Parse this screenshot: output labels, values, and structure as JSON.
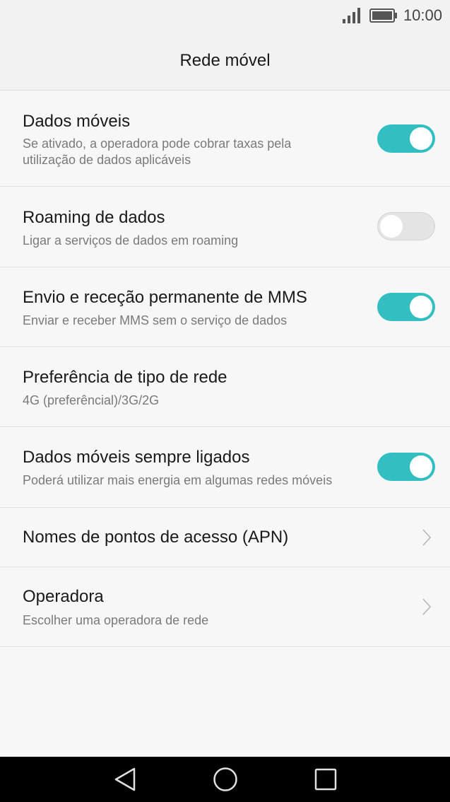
{
  "status_bar": {
    "signal_icon": "signal-bars-icon",
    "battery_icon": "battery-icon",
    "time": "10:00"
  },
  "header": {
    "title": "Rede móvel"
  },
  "settings": {
    "mobile_data": {
      "title": "Dados móveis",
      "subtitle": "Se ativado, a operadora pode cobrar taxas pela utilização de dados aplicáveis",
      "enabled": true
    },
    "data_roaming": {
      "title": "Roaming de dados",
      "subtitle": "Ligar a serviços de dados em roaming",
      "enabled": false
    },
    "mms": {
      "title": "Envio e receção permanente de MMS",
      "subtitle": "Enviar e receber MMS sem o serviço de dados",
      "enabled": true
    },
    "network_type": {
      "title": "Preferência de tipo de rede",
      "subtitle": "4G (preferêncial)/3G/2G"
    },
    "always_on": {
      "title": "Dados móveis sempre ligados",
      "subtitle": "Poderá utilizar mais energia em algumas redes móveis",
      "enabled": true
    },
    "apn": {
      "title": "Nomes de pontos de acesso (APN)",
      "icon": "chevron-right-icon"
    },
    "carrier": {
      "title": "Operadora",
      "subtitle": "Escolher uma operadora de rede",
      "icon": "chevron-right-icon"
    }
  },
  "nav_bar": {
    "back_icon": "back-triangle-icon",
    "home_icon": "home-circle-icon",
    "recents_icon": "recents-square-icon"
  },
  "colors": {
    "accent": "#33bfc1",
    "toggle_off": "#e4e4e4",
    "background": "#f7f7f7",
    "header": "#f2f2f2",
    "nav_bar": "#000000"
  }
}
